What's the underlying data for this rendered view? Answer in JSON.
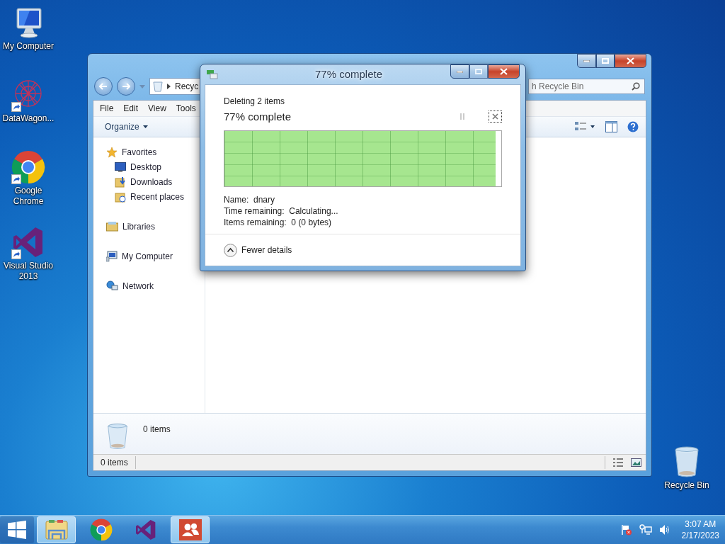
{
  "desktop_icons": [
    {
      "kind": "computer",
      "label": "My Computer",
      "shortcut": false
    },
    {
      "kind": "datawagon",
      "label": "DataWagon...",
      "shortcut": true
    },
    {
      "kind": "chrome",
      "label": "Google Chrome",
      "shortcut": true
    },
    {
      "kind": "vs",
      "label": "Visual Studio 2013",
      "shortcut": true
    },
    {
      "kind": "recyclebin",
      "label": "Recycle Bin",
      "shortcut": false
    }
  ],
  "explorer": {
    "address": "Recyc",
    "search_placeholder": "h Recycle Bin",
    "menu": [
      "File",
      "Edit",
      "View",
      "Tools"
    ],
    "organize": "Organize",
    "nav": [
      {
        "kind": "favorites",
        "label": "Favorites",
        "children": [
          {
            "kind": "desktop",
            "label": "Desktop"
          },
          {
            "kind": "downloads",
            "label": "Downloads"
          },
          {
            "kind": "recent",
            "label": "Recent places"
          }
        ]
      },
      {
        "kind": "libraries",
        "label": "Libraries"
      },
      {
        "kind": "computer",
        "label": "My Computer"
      },
      {
        "kind": "network",
        "label": "Network"
      }
    ],
    "details_count": "0 items",
    "status": "0 items"
  },
  "dialog": {
    "title": "77% complete",
    "heading": "Deleting 2 items",
    "progress_text": "77% complete",
    "level": 0.98,
    "details": [
      "Name:  dnary",
      "Time remaining:  Calculating...",
      "Items remaining:  0 (0 bytes)"
    ],
    "toggle": {
      "label": "Fewer details",
      "expanded": true
    }
  },
  "taskbar": {
    "items": [
      {
        "kind": "start",
        "selected": false
      },
      {
        "kind": "explorer",
        "selected": true
      },
      {
        "kind": "chrome",
        "selected": false
      },
      {
        "kind": "vs",
        "selected": false
      },
      {
        "kind": "people",
        "selected": true
      }
    ],
    "time": "3:07 AM",
    "date": "2/17/2023"
  }
}
